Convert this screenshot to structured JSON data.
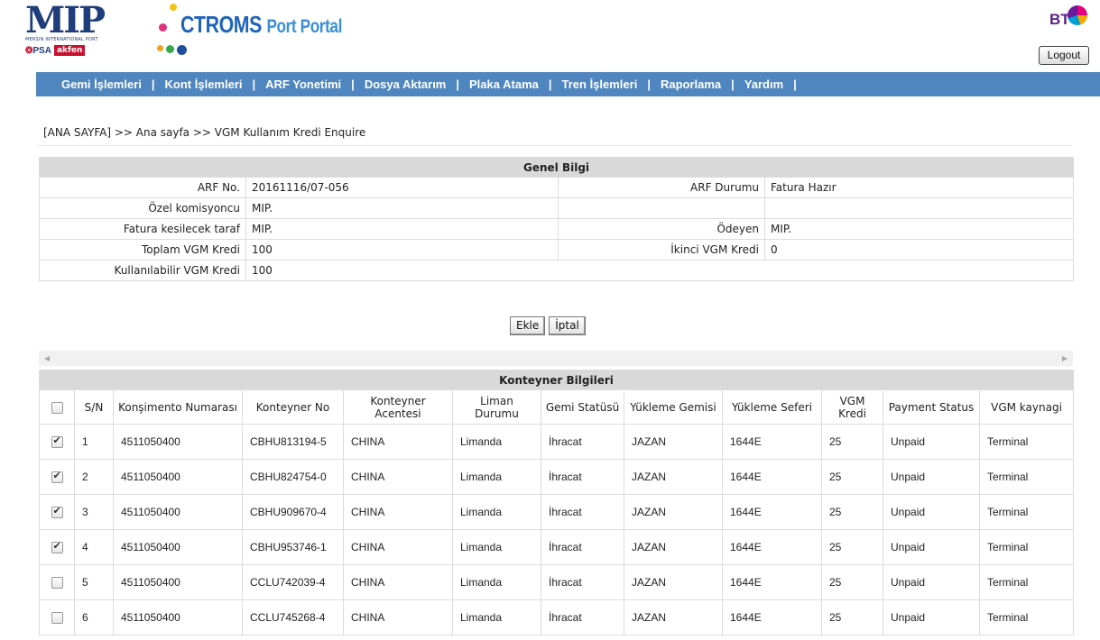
{
  "header": {
    "mip_logo": "MIP",
    "mip_subtitle": "MERSIN INTERNATIONAL PORT",
    "psa_logo": "PSA",
    "akfen_logo": "akfen",
    "portal_title": "CTROMS",
    "portal_subtitle": "Port Portal",
    "bt_logo": "BT",
    "logout_label": "Logout"
  },
  "nav": {
    "items": [
      {
        "label": "Gemi İşlemleri"
      },
      {
        "label": "Kont İşlemleri"
      },
      {
        "label": "ARF Yonetimi"
      },
      {
        "label": "Dosya Aktarım"
      },
      {
        "label": "Plaka Atama"
      },
      {
        "label": "Tren İşlemleri"
      },
      {
        "label": "Raporlama"
      },
      {
        "label": "Yardım"
      }
    ],
    "separator": "|"
  },
  "breadcrumb": "[ANA SAYFA] >> Ana sayfa >> VGM Kullanım Kredi Enquire",
  "genel_bilgi": {
    "title": "Genel Bilgi",
    "arf_no_label": "ARF No.",
    "arf_no_value": "20161116/07-056",
    "arf_durumu_label": "ARF Durumu",
    "arf_durumu_value": "Fatura Hazır",
    "ozel_label": "Özel komisyoncu",
    "ozel_value": "MIP.",
    "fatura_label": "Fatura kesilecek taraf",
    "fatura_value": "MIP.",
    "odeyen_label": "Ödeyen",
    "odeyen_value": "MIP.",
    "toplam_label": "Toplam VGM Kredi",
    "toplam_value": "100",
    "ikinci_label": "İkinci VGM Kredi",
    "ikinci_value": "0",
    "kullanilabilir_label": "Kullanılabilir VGM Kredi",
    "kullanilabilir_value": "100"
  },
  "buttons": {
    "ekle": "Ekle",
    "iptal": "İptal"
  },
  "konteyner": {
    "title": "Konteyner Bilgileri",
    "headers": [
      "S/N",
      "Konşimento Numarası",
      "Konteyner No",
      "Konteyner Acentesi",
      "Liman Durumu",
      "Gemi Statüsü",
      "Yükleme Gemisi",
      "Yükleme Seferi",
      "VGM Kredi",
      "Payment Status",
      "VGM kaynagi"
    ],
    "rows": [
      {
        "checked": true,
        "cells": [
          "1",
          "4511050400",
          "CBHU813194-5",
          "CHINA",
          "Limanda",
          "İhracat",
          "JAZAN",
          "1644E",
          "25",
          "Unpaid",
          "Terminal"
        ]
      },
      {
        "checked": true,
        "cells": [
          "2",
          "4511050400",
          "CBHU824754-0",
          "CHINA",
          "Limanda",
          "İhracat",
          "JAZAN",
          "1644E",
          "25",
          "Unpaid",
          "Terminal"
        ]
      },
      {
        "checked": true,
        "cells": [
          "3",
          "4511050400",
          "CBHU909670-4",
          "CHINA",
          "Limanda",
          "İhracat",
          "JAZAN",
          "1644E",
          "25",
          "Unpaid",
          "Terminal"
        ]
      },
      {
        "checked": true,
        "cells": [
          "4",
          "4511050400",
          "CBHU953746-1",
          "CHINA",
          "Limanda",
          "İhracat",
          "JAZAN",
          "1644E",
          "25",
          "Unpaid",
          "Terminal"
        ]
      },
      {
        "checked": false,
        "cells": [
          "5",
          "4511050400",
          "CCLU742039-4",
          "CHINA",
          "Limanda",
          "İhracat",
          "JAZAN",
          "1644E",
          "25",
          "Unpaid",
          "Terminal"
        ]
      },
      {
        "checked": false,
        "cells": [
          "6",
          "4511050400",
          "CCLU745268-4",
          "CHINA",
          "Limanda",
          "İhracat",
          "JAZAN",
          "1644E",
          "25",
          "Unpaid",
          "Terminal"
        ]
      }
    ]
  }
}
